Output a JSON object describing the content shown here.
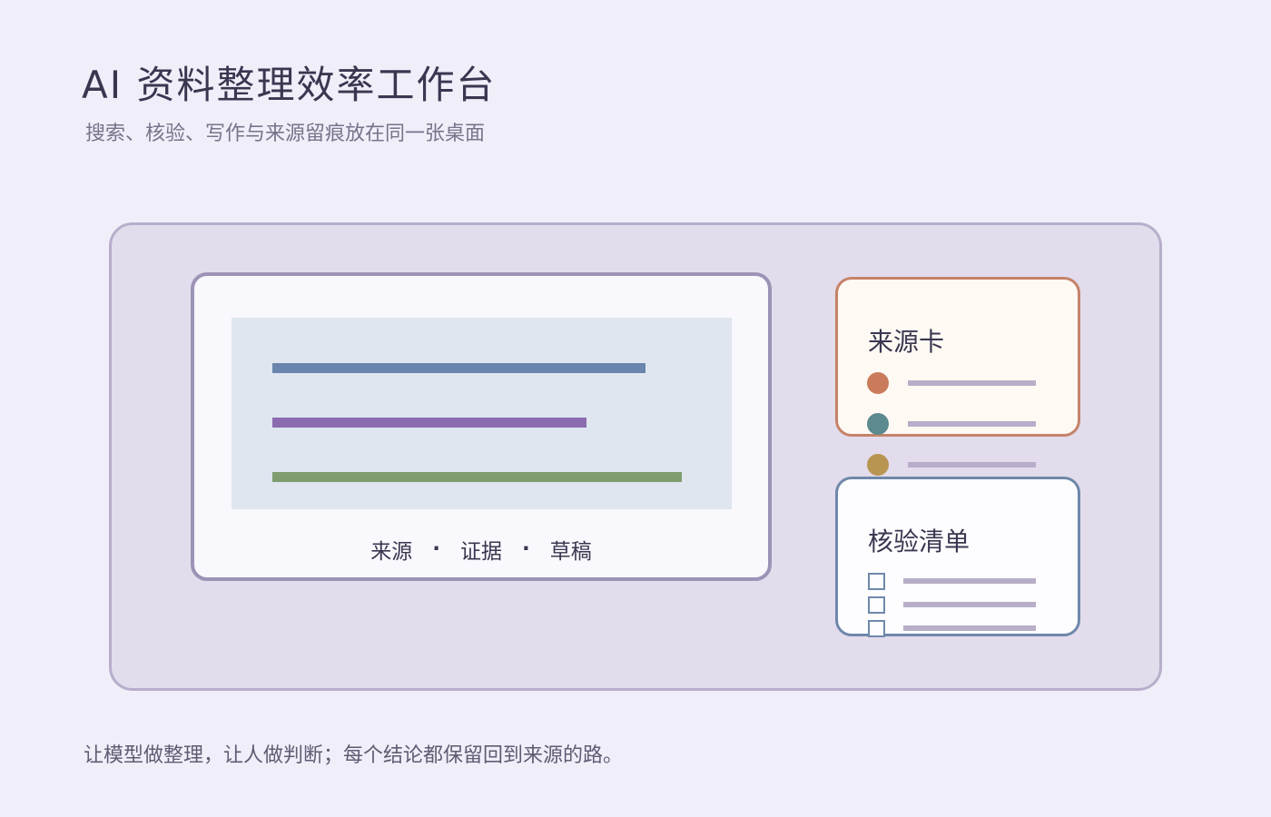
{
  "header": {
    "title": "AI 资料整理效率工作台",
    "subtitle": "搜索、核验、写作与来源留痕放在同一张桌面"
  },
  "editor": {
    "caption_items": [
      "来源",
      "证据",
      "草稿"
    ],
    "separator": "·"
  },
  "colors": {
    "background": "#f0eef9",
    "bar_blue": "#6a85ad",
    "bar_purple": "#8b6cb0",
    "bar_green": "#7f9d6e",
    "source_dot_1": "#c97b5b",
    "source_dot_2": "#5b8a8f",
    "source_dot_3": "#b89550"
  },
  "source_card": {
    "title": "来源卡",
    "icons": [
      "orange-dot-icon",
      "teal-dot-icon",
      "gold-dot-icon"
    ]
  },
  "check_card": {
    "title": "核验清单",
    "icons": [
      "checkbox-icon",
      "checkbox-icon",
      "checkbox-icon"
    ]
  },
  "footer": {
    "text": "让模型做整理，让人做判断；每个结论都保留回到来源的路。"
  }
}
